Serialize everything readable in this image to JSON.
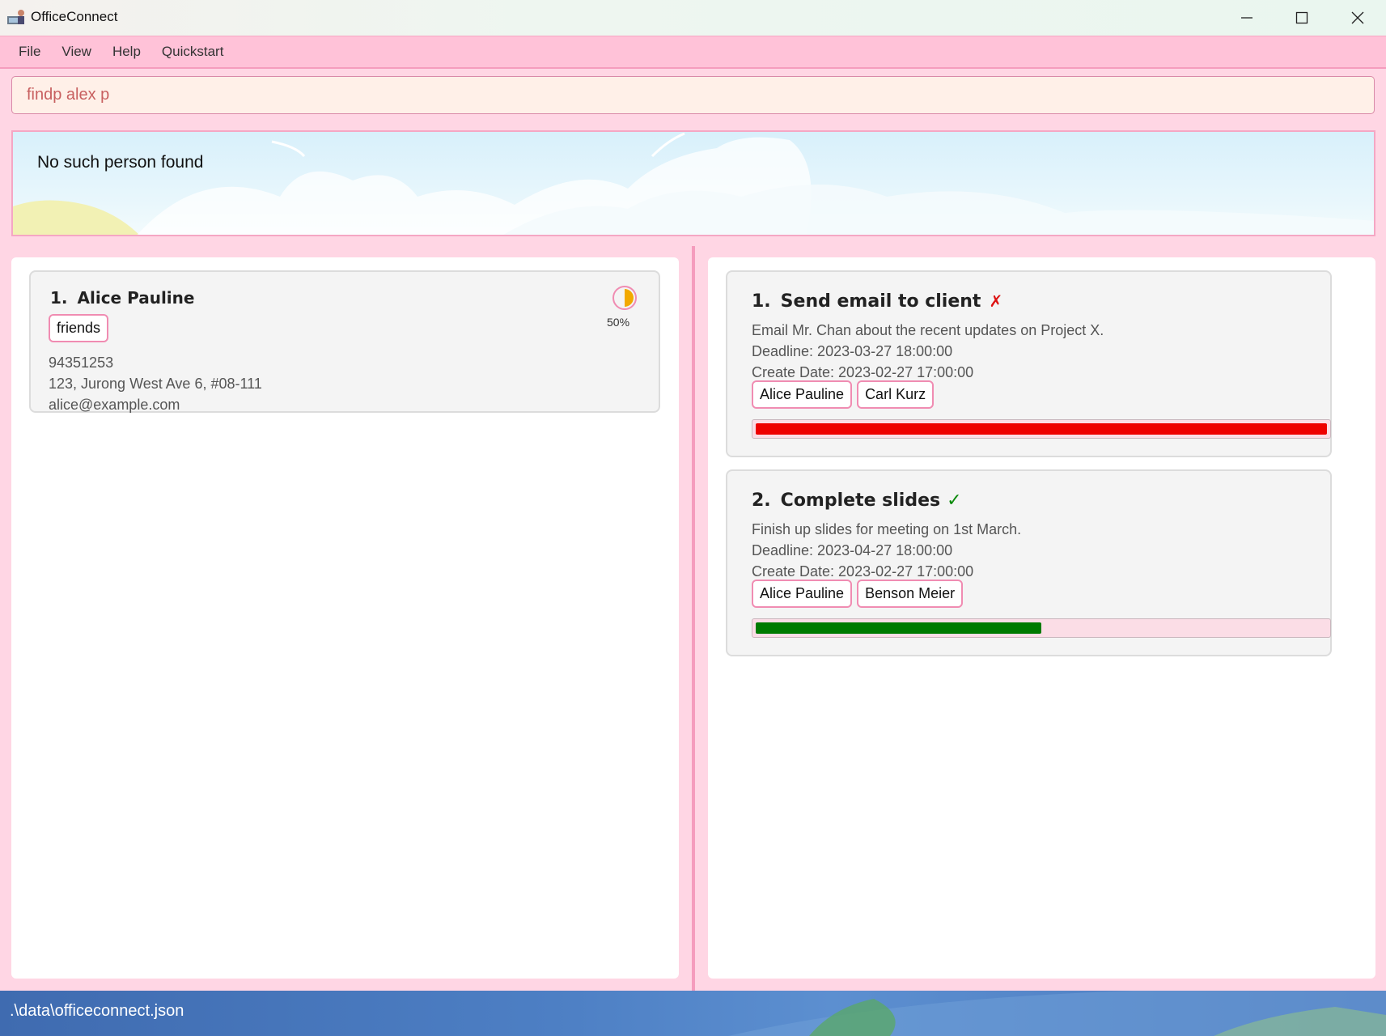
{
  "window": {
    "title": "OfficeConnect",
    "icon": "app-icon"
  },
  "menu": {
    "items": [
      "File",
      "View",
      "Help",
      "Quickstart"
    ]
  },
  "command": {
    "value": "findp alex p"
  },
  "result": {
    "message": "No such person found"
  },
  "persons": [
    {
      "index": "1.",
      "name": "Alice Pauline",
      "tags": [
        "friends"
      ],
      "phone": "94351253",
      "address": "123, Jurong West Ave 6, #08-111",
      "email": "alice@example.com",
      "progress": 0.5,
      "progress_label": "50%"
    }
  ],
  "tasks": [
    {
      "index": "1.",
      "title": "Send email to client",
      "status": "✗",
      "status_icon": "cross-icon",
      "description": "Email Mr. Chan about the recent updates on Project X.",
      "deadline": "Deadline: 2023-03-27 18:00:00",
      "create_date": "Create Date: 2023-02-27 17:00:00",
      "assignees": [
        "Alice Pauline",
        "Carl Kurz"
      ],
      "progress": 1.0,
      "bar_color": "#ee0000"
    },
    {
      "index": "2.",
      "title": "Complete slides",
      "status": "✓",
      "status_icon": "check-icon",
      "description": "Finish up slides for meeting on 1st March.",
      "deadline": "Deadline: 2023-04-27 18:00:00",
      "create_date": "Create Date: 2023-02-27 17:00:00",
      "assignees": [
        "Alice Pauline",
        "Benson Meier"
      ],
      "progress": 0.5,
      "bar_color": "#007a00"
    }
  ],
  "statusbar": {
    "path": ".\\data\\officeconnect.json"
  },
  "colors": {
    "accent_pink": "#ffc2d8",
    "tag_border": "#f08cb2",
    "progress_half": "#f2a900"
  }
}
